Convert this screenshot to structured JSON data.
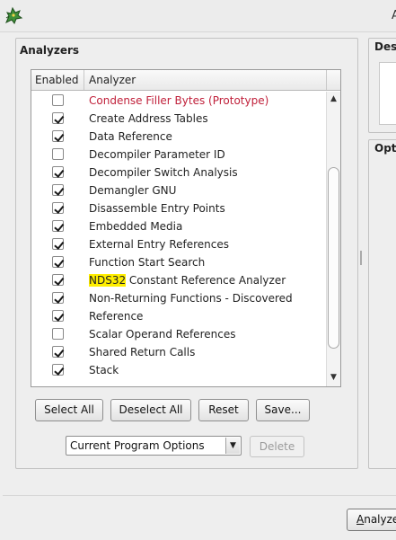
{
  "window": {
    "title": "A",
    "icon": "dragon-icon"
  },
  "analyzers_panel": {
    "title": "Analyzers",
    "columns": {
      "enabled": "Enabled",
      "analyzer": "Analyzer"
    },
    "rows": [
      {
        "name": "Condense Filler Bytes (Prototype)",
        "enabled": false,
        "prototype": true
      },
      {
        "name": "Create Address Tables",
        "enabled": true
      },
      {
        "name": "Data Reference",
        "enabled": true
      },
      {
        "name": "Decompiler Parameter ID",
        "enabled": false
      },
      {
        "name": "Decompiler Switch Analysis",
        "enabled": true
      },
      {
        "name": "Demangler GNU",
        "enabled": true
      },
      {
        "name": "Disassemble Entry Points",
        "enabled": true
      },
      {
        "name": "Embedded Media",
        "enabled": true
      },
      {
        "name": "External Entry References",
        "enabled": true
      },
      {
        "name": "Function Start Search",
        "enabled": true
      },
      {
        "name": "NDS32 Constant Reference Analyzer",
        "enabled": true,
        "highlight": "NDS32"
      },
      {
        "name": "Non-Returning Functions - Discovered",
        "enabled": true
      },
      {
        "name": "Reference",
        "enabled": true
      },
      {
        "name": "Scalar Operand References",
        "enabled": false
      },
      {
        "name": "Shared Return Calls",
        "enabled": true
      },
      {
        "name": "Stack",
        "enabled": true
      }
    ],
    "buttons": {
      "select_all": "Select All",
      "deselect_all": "Deselect All",
      "reset": "Reset",
      "save": "Save..."
    },
    "options_select": {
      "value": "Current Program Options"
    },
    "delete_label": "Delete"
  },
  "description_panel": {
    "title": "Desc"
  },
  "options_panel": {
    "title": "Opti"
  },
  "analyze_button": {
    "label": "Analyze"
  },
  "colors": {
    "prototype": "#c0203a",
    "highlight": "#ffee00"
  }
}
